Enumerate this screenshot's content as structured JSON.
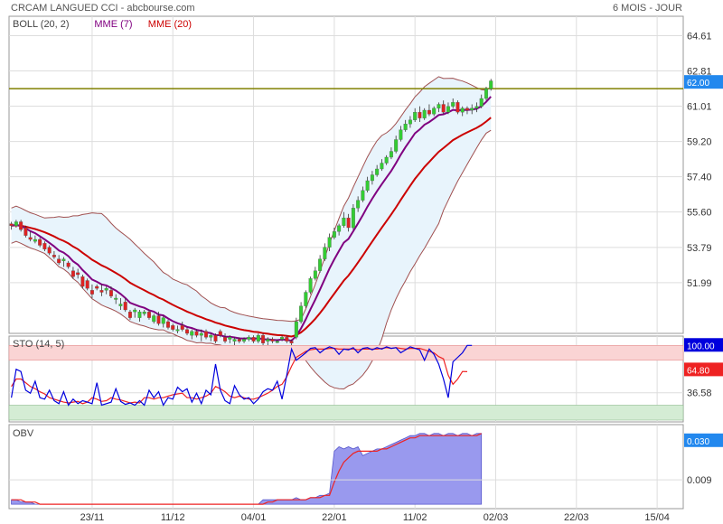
{
  "header": {
    "title": "CRCAM LANGUED CCI - abcbourse.com",
    "period": "6 MOIS - JOUR"
  },
  "colors": {
    "up": "#33cc33",
    "down": "#dd2222",
    "mme7": "#800080",
    "mme20": "#cc0000",
    "boll_band": "#a05050",
    "boll_fill": "#e8f4fc",
    "level_line": "#808000",
    "sto_k": "#0000dd",
    "sto_d": "#ee2222",
    "sto_high_zone": "#fad4d4",
    "sto_low_zone": "#d4ecd4",
    "obv_fill": "#9999ee",
    "obv_signal": "#ee2222",
    "grid": "#dddddd"
  },
  "chart_data": [
    {
      "type": "candlestick",
      "legend": [
        {
          "label": "BOLL (20, 2)",
          "color": "#a05050"
        },
        {
          "label": "MME (7)",
          "color": "#800080"
        },
        {
          "label": "MME (20)",
          "color": "#cc0000"
        }
      ],
      "y_ticks": [
        "64.61",
        "62.81",
        "61.01",
        "59.20",
        "57.40",
        "55.60",
        "53.79",
        "51.99"
      ],
      "ylim": [
        49.4,
        65.6
      ],
      "grid": true,
      "level_line": {
        "value": 61.9
      },
      "last_value_label": "62.00",
      "candles": [
        [
          55.0,
          55.1,
          54.7,
          54.9
        ],
        [
          54.9,
          55.2,
          54.8,
          55.1
        ],
        [
          55.1,
          55.2,
          54.6,
          54.7
        ],
        [
          54.8,
          54.9,
          54.3,
          54.4
        ],
        [
          54.3,
          54.6,
          54.1,
          54.2
        ],
        [
          54.1,
          54.4,
          54.0,
          54.2
        ],
        [
          54.2,
          54.3,
          53.8,
          53.9
        ],
        [
          54.0,
          54.1,
          53.6,
          53.7
        ],
        [
          53.8,
          53.9,
          53.4,
          53.5
        ],
        [
          53.4,
          53.6,
          53.2,
          53.3
        ],
        [
          53.2,
          53.4,
          52.9,
          53.0
        ],
        [
          53.1,
          53.3,
          52.8,
          53.2
        ],
        [
          53.0,
          53.1,
          52.7,
          52.8
        ],
        [
          52.6,
          52.8,
          52.2,
          52.3
        ],
        [
          52.5,
          52.7,
          52.2,
          52.4
        ],
        [
          52.3,
          52.4,
          51.7,
          51.8
        ],
        [
          52.1,
          52.2,
          51.6,
          51.7
        ],
        [
          51.6,
          51.9,
          51.2,
          51.4
        ],
        [
          51.8,
          51.9,
          51.6,
          51.7
        ],
        [
          51.6,
          51.9,
          51.3,
          51.5
        ],
        [
          51.6,
          51.8,
          51.4,
          51.7
        ],
        [
          51.6,
          51.8,
          51.2,
          51.3
        ],
        [
          51.2,
          51.4,
          50.9,
          51.2
        ],
        [
          50.8,
          51.2,
          50.6,
          50.9
        ],
        [
          51.0,
          51.2,
          50.5,
          50.6
        ],
        [
          50.5,
          50.6,
          50.1,
          50.2
        ],
        [
          50.5,
          50.7,
          50.2,
          50.6
        ],
        [
          50.2,
          50.6,
          50.0,
          50.5
        ],
        [
          50.4,
          50.6,
          50.3,
          50.5
        ],
        [
          50.5,
          50.6,
          50.1,
          50.2
        ],
        [
          50.0,
          50.4,
          49.9,
          50.3
        ],
        [
          50.3,
          50.5,
          49.8,
          49.9
        ],
        [
          49.9,
          50.3,
          49.7,
          50.2
        ],
        [
          50.0,
          50.1,
          49.6,
          49.7
        ],
        [
          49.8,
          49.9,
          49.5,
          49.6
        ],
        [
          49.6,
          49.8,
          49.4,
          49.6
        ],
        [
          49.8,
          50.0,
          49.5,
          49.6
        ],
        [
          49.6,
          49.7,
          49.3,
          49.4
        ],
        [
          49.3,
          49.6,
          49.1,
          49.5
        ],
        [
          49.5,
          49.6,
          49.2,
          49.3
        ],
        [
          49.3,
          49.6,
          49.0,
          49.4
        ],
        [
          49.5,
          49.6,
          49.1,
          49.2
        ],
        [
          49.2,
          49.4,
          49.0,
          49.3
        ],
        [
          49.3,
          49.4,
          48.9,
          49.0
        ],
        [
          49.5,
          49.6,
          49.2,
          49.3
        ],
        [
          49.2,
          49.4,
          48.9,
          49.0
        ],
        [
          49.1,
          49.3,
          48.9,
          49.2
        ],
        [
          49.0,
          49.2,
          48.8,
          49.1
        ],
        [
          49.1,
          49.2,
          48.9,
          49.0
        ],
        [
          49.0,
          49.2,
          48.9,
          49.1
        ],
        [
          49.1,
          49.3,
          49.0,
          49.2
        ],
        [
          49.2,
          49.3,
          48.9,
          49.0
        ],
        [
          49.0,
          49.4,
          48.9,
          49.3
        ],
        [
          49.3,
          49.4,
          48.8,
          48.9
        ],
        [
          49.0,
          49.2,
          48.8,
          49.1
        ],
        [
          49.1,
          49.2,
          48.9,
          49.0
        ],
        [
          49.0,
          49.1,
          48.9,
          49.0
        ],
        [
          49.1,
          49.3,
          49.0,
          49.2
        ],
        [
          49.2,
          49.3,
          48.9,
          49.0
        ],
        [
          49.0,
          49.1,
          48.8,
          48.9
        ],
        [
          49.2,
          50.2,
          49.1,
          50.0
        ],
        [
          50.0,
          51.0,
          49.9,
          50.8
        ],
        [
          50.8,
          51.6,
          50.7,
          51.5
        ],
        [
          51.5,
          52.3,
          51.4,
          52.2
        ],
        [
          52.2,
          52.8,
          52.1,
          52.6
        ],
        [
          52.6,
          53.4,
          52.5,
          53.2
        ],
        [
          53.2,
          54.0,
          53.1,
          53.8
        ],
        [
          53.8,
          54.5,
          53.6,
          54.3
        ],
        [
          54.3,
          54.8,
          54.2,
          54.6
        ],
        [
          54.6,
          55.0,
          54.4,
          54.9
        ],
        [
          54.9,
          55.6,
          54.8,
          55.3
        ],
        [
          55.3,
          55.5,
          54.6,
          54.8
        ],
        [
          54.8,
          56.0,
          54.7,
          55.8
        ],
        [
          55.8,
          56.4,
          55.6,
          56.2
        ],
        [
          56.2,
          56.9,
          56.1,
          56.7
        ],
        [
          56.7,
          57.4,
          56.6,
          57.2
        ],
        [
          57.2,
          57.7,
          57.0,
          57.5
        ],
        [
          57.5,
          58.0,
          57.4,
          57.8
        ],
        [
          57.8,
          58.3,
          57.7,
          58.1
        ],
        [
          58.1,
          58.5,
          58.0,
          58.4
        ],
        [
          58.4,
          58.9,
          58.3,
          58.7
        ],
        [
          58.7,
          59.5,
          58.6,
          59.3
        ],
        [
          59.3,
          60.0,
          59.2,
          59.8
        ],
        [
          59.8,
          60.3,
          59.7,
          60.1
        ],
        [
          60.1,
          60.5,
          59.9,
          60.3
        ],
        [
          60.3,
          60.9,
          60.2,
          60.7
        ],
        [
          60.7,
          61.0,
          60.2,
          60.4
        ],
        [
          60.4,
          60.9,
          60.3,
          60.8
        ],
        [
          60.8,
          61.1,
          60.5,
          60.6
        ],
        [
          60.6,
          61.0,
          60.5,
          60.9
        ],
        [
          60.9,
          61.2,
          60.7,
          61.1
        ],
        [
          61.1,
          61.3,
          60.6,
          60.7
        ],
        [
          60.7,
          61.2,
          60.6,
          61.0
        ],
        [
          61.0,
          61.4,
          60.9,
          61.2
        ],
        [
          61.2,
          61.3,
          60.6,
          60.7
        ],
        [
          60.7,
          61.0,
          60.5,
          60.9
        ],
        [
          60.9,
          61.0,
          60.6,
          60.8
        ],
        [
          60.8,
          61.1,
          60.6,
          60.9
        ],
        [
          60.9,
          61.2,
          60.7,
          61.0
        ],
        [
          61.0,
          61.6,
          60.9,
          61.4
        ],
        [
          61.4,
          62.0,
          61.3,
          61.9
        ],
        [
          61.9,
          62.4,
          61.8,
          62.3
        ]
      ]
    },
    {
      "type": "line",
      "legend": [
        {
          "label": "STO (14, 5)",
          "color": "#0000dd"
        }
      ],
      "y_ticks": [
        "36.58"
      ],
      "ylim": [
        0,
        110
      ],
      "zones": [
        {
          "from": 80,
          "to": 100
        },
        {
          "from": 0,
          "to": 20
        }
      ],
      "last_values": [
        {
          "label": "100.00",
          "color": "#0000dd"
        },
        {
          "label": "64.80",
          "color": "#ee2222"
        }
      ],
      "series": [
        {
          "name": "K",
          "values": [
            30,
            68,
            65,
            40,
            36,
            52,
            30,
            28,
            40,
            26,
            22,
            38,
            20,
            28,
            22,
            26,
            24,
            22,
            50,
            20,
            22,
            24,
            42,
            25,
            21,
            23,
            20,
            26,
            20,
            40,
            30,
            38,
            20,
            30,
            28,
            44,
            38,
            42,
            24,
            36,
            22,
            40,
            34,
            75,
            40,
            26,
            22,
            46,
            34,
            28,
            30,
            22,
            28,
            38,
            42,
            40,
            52,
            28,
            60,
            95,
            80,
            85,
            90,
            96,
            97,
            90,
            95,
            98,
            96,
            88,
            95,
            94,
            97,
            90,
            96,
            97,
            94,
            97,
            95,
            98,
            96,
            97,
            90,
            94,
            98,
            96,
            94,
            80,
            95,
            88,
            75,
            55,
            30,
            78,
            84,
            90,
            100,
            100
          ]
        },
        {
          "name": "D",
          "values": [
            45,
            55,
            55,
            50,
            45,
            42,
            38,
            35,
            30,
            28,
            26,
            24,
            23,
            24,
            25,
            22,
            24,
            30,
            28,
            25,
            26,
            30,
            28,
            27,
            25,
            23,
            24,
            23,
            30,
            30,
            28,
            30,
            30,
            32,
            34,
            35,
            36,
            30,
            30,
            28,
            30,
            32,
            36,
            45,
            42,
            38,
            32,
            30,
            32,
            30,
            28,
            28,
            30,
            33,
            36,
            40,
            45,
            48,
            58,
            72,
            84,
            88,
            92,
            94,
            95,
            95,
            95,
            96,
            96,
            95,
            95,
            95,
            95,
            94,
            95,
            95,
            95,
            95,
            96,
            97,
            96,
            97,
            96,
            95,
            96,
            96,
            96,
            94,
            92,
            90,
            85,
            82,
            60,
            48,
            55,
            65,
            64.8
          ]
        }
      ]
    },
    {
      "type": "area",
      "legend": [
        {
          "label": "OBV",
          "color": "#9999ee"
        }
      ],
      "y_ticks": [
        "0.009"
      ],
      "last_value_label": "0.030",
      "series": [
        {
          "name": "OBV",
          "values": [
            0.0,
            0.0,
            -0.001,
            -0.001,
            -0.001,
            -0.002,
            -0.002,
            -0.002,
            -0.002,
            -0.002,
            -0.002,
            -0.002,
            -0.002,
            -0.002,
            -0.002,
            -0.002,
            -0.002,
            -0.002,
            -0.002,
            -0.002,
            -0.002,
            -0.002,
            -0.002,
            -0.002,
            -0.002,
            -0.002,
            -0.002,
            -0.002,
            -0.002,
            -0.002,
            -0.002,
            -0.002,
            -0.002,
            -0.002,
            -0.002,
            -0.002,
            -0.002,
            -0.002,
            -0.002,
            -0.002,
            -0.002,
            -0.002,
            -0.002,
            -0.002,
            -0.002,
            -0.002,
            -0.002,
            -0.002,
            -0.002,
            -0.002,
            -0.002,
            -0.002,
            -0.002,
            0.0,
            0.0,
            0.0,
            0.0,
            0.0,
            0.0,
            0.0,
            0.001,
            0.0,
            0.0,
            0.001,
            0.001,
            0.002,
            0.002,
            0.003,
            0.022,
            0.024,
            0.023,
            0.024,
            0.023,
            0.024,
            0.02,
            0.021,
            0.022,
            0.023,
            0.023,
            0.024,
            0.025,
            0.026,
            0.027,
            0.028,
            0.029,
            0.029,
            0.03,
            0.03,
            0.029,
            0.03,
            0.03,
            0.029,
            0.03,
            0.03,
            0.029,
            0.03,
            0.03,
            0.029,
            0.03,
            0.03
          ]
        },
        {
          "name": "Signal",
          "values": [
            0.0,
            0.0,
            0.0,
            -0.001,
            -0.001,
            -0.001,
            -0.002,
            -0.002,
            -0.002,
            -0.002,
            -0.002,
            -0.002,
            -0.002,
            -0.002,
            -0.002,
            -0.002,
            -0.002,
            -0.002,
            -0.002,
            -0.002,
            -0.002,
            -0.002,
            -0.002,
            -0.002,
            -0.002,
            -0.002,
            -0.002,
            -0.002,
            -0.002,
            -0.002,
            -0.002,
            -0.002,
            -0.002,
            -0.002,
            -0.002,
            -0.002,
            -0.002,
            -0.002,
            -0.002,
            -0.002,
            -0.002,
            -0.002,
            -0.002,
            -0.002,
            -0.002,
            -0.002,
            -0.002,
            -0.002,
            -0.002,
            -0.002,
            -0.002,
            -0.002,
            -0.002,
            -0.002,
            -0.001,
            -0.001,
            0.0,
            0.0,
            0.0,
            0.0,
            0.0,
            0.0,
            0.0,
            0.001,
            0.001,
            0.001,
            0.002,
            0.002,
            0.008,
            0.013,
            0.017,
            0.019,
            0.021,
            0.022,
            0.022,
            0.022,
            0.022,
            0.022,
            0.023,
            0.023,
            0.024,
            0.025,
            0.026,
            0.027,
            0.028,
            0.028,
            0.029,
            0.029,
            0.029,
            0.029,
            0.029,
            0.029,
            0.029,
            0.029,
            0.029,
            0.029,
            0.029,
            0.029,
            0.029,
            0.03
          ]
        }
      ]
    }
  ],
  "x_ticks": [
    "23/11",
    "11/12",
    "04/01",
    "22/01",
    "11/02",
    "02/03",
    "22/03",
    "15/04"
  ],
  "x_tick_index": [
    17,
    34,
    51,
    68,
    85,
    102,
    119,
    136
  ],
  "x_total_slots": 142
}
